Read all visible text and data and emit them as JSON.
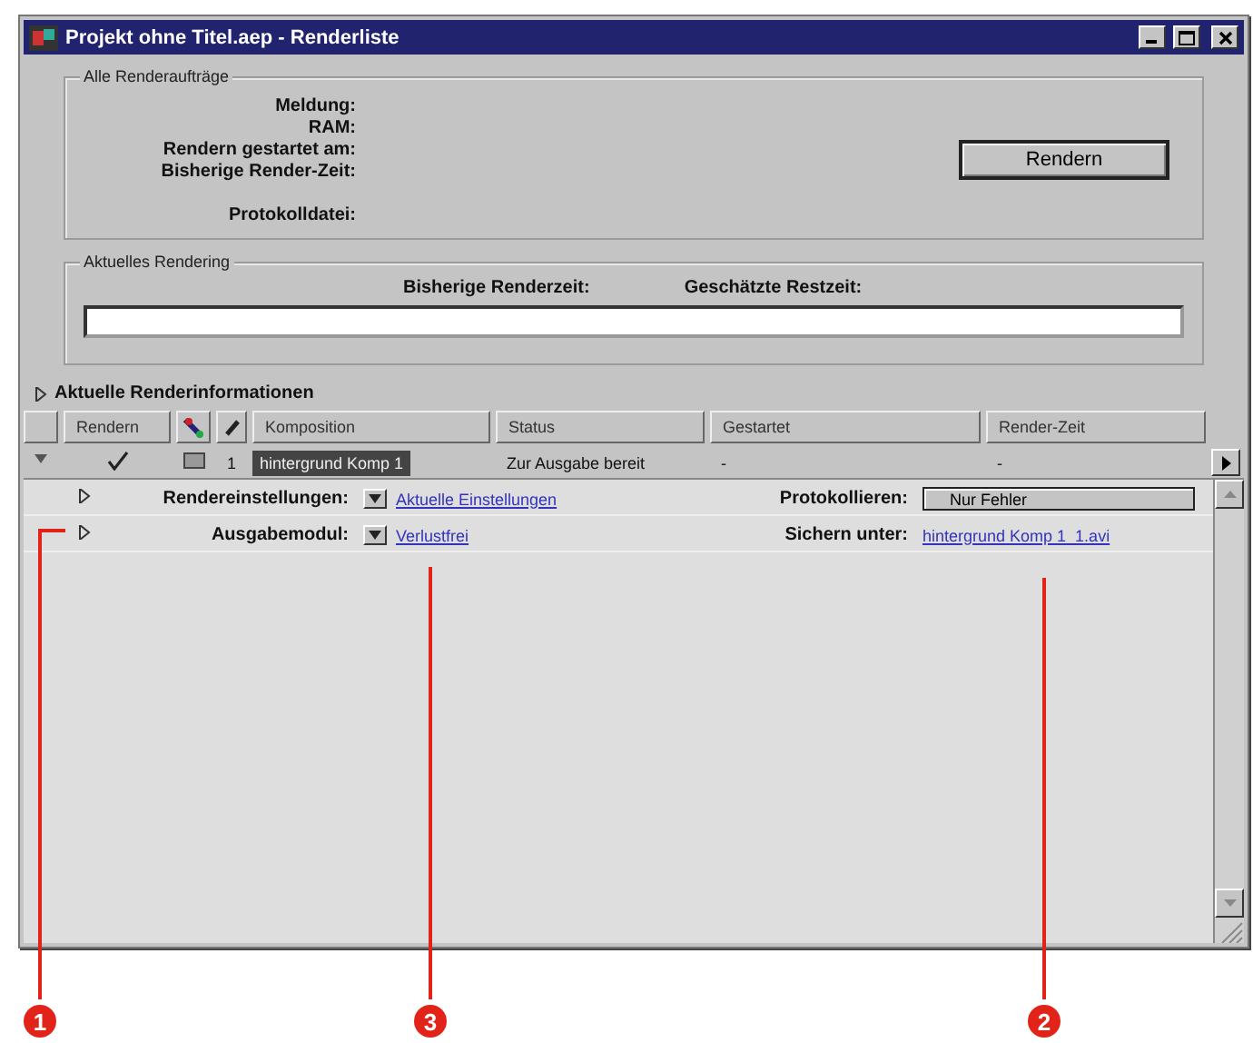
{
  "window": {
    "title": "Projekt ohne Titel.aep - Renderliste"
  },
  "all_jobs": {
    "legend": "Alle Renderaufträge",
    "labels": [
      "Meldung:",
      "RAM:",
      "Rendern gestartet am:",
      "Bisherige Render-Zeit:",
      "Protokolldatei:"
    ],
    "button": "Rendern"
  },
  "current": {
    "legend": "Aktuelles Rendering",
    "elapsed_label": "Bisherige Renderzeit:",
    "remaining_label": "Geschätzte Restzeit:"
  },
  "info": {
    "label": "Aktuelle Renderinformationen",
    "expanded": false
  },
  "table": {
    "columns": [
      {
        "kind": "blank"
      },
      {
        "kind": "text",
        "label": "Rendern"
      },
      {
        "kind": "icon"
      },
      {
        "kind": "icon"
      },
      {
        "kind": "text",
        "label": "Komposition"
      },
      {
        "kind": "text",
        "label": "Status"
      },
      {
        "kind": "text",
        "label": "Gestartet"
      },
      {
        "kind": "text",
        "label": "Render-Zeit"
      }
    ],
    "rows": [
      {
        "expanded": true,
        "checked": true,
        "number": "1",
        "composition": "hintergrund Komp 1",
        "selected": true,
        "status": "Zur Ausgabe bereit",
        "started": "-",
        "render_time": "-",
        "settings": [
          {
            "label": "Rendereinstellungen:",
            "expanded": false,
            "value": "Aktuelle Einstellungen",
            "right": {
              "kind": "dropdown",
              "label": "Protokollieren:",
              "value": "Nur Fehler"
            }
          },
          {
            "label": "Ausgabemodul:",
            "expanded": false,
            "value": "Verlustfrei",
            "right": {
              "kind": "link",
              "label": "Sichern unter:",
              "value": "hintergrund Komp 1_1.avi"
            }
          }
        ]
      }
    ]
  },
  "callouts": [
    {
      "number": "1"
    },
    {
      "number": "3"
    },
    {
      "number": "2"
    }
  ]
}
